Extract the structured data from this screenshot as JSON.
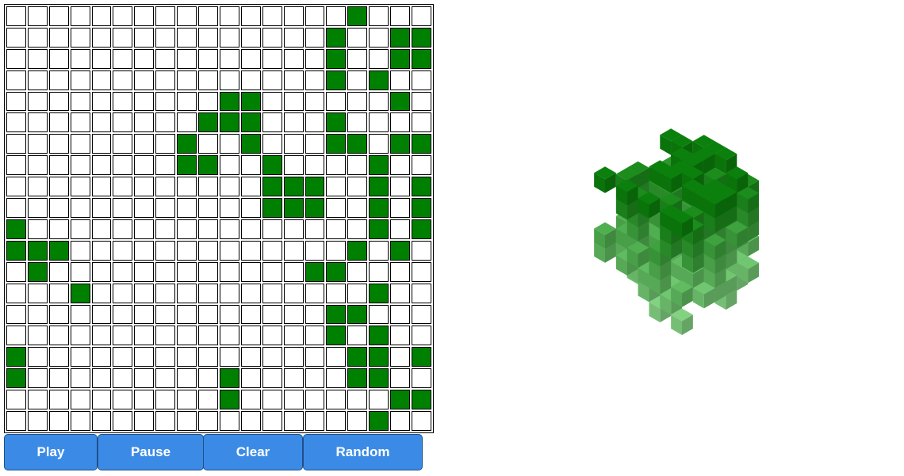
{
  "controls": {
    "buttons": [
      {
        "id": "play",
        "label": "Play"
      },
      {
        "id": "pause",
        "label": "Pause"
      },
      {
        "id": "clear",
        "label": "Clear"
      },
      {
        "id": "random",
        "label": "Random"
      }
    ]
  },
  "grid": {
    "rows": 20,
    "cols": 20,
    "live_color": "#008000",
    "dead_color": "#ffffff",
    "alive": [
      [
        0,
        16
      ],
      [
        1,
        15
      ],
      [
        1,
        18
      ],
      [
        1,
        19
      ],
      [
        2,
        15
      ],
      [
        2,
        18
      ],
      [
        2,
        19
      ],
      [
        3,
        15
      ],
      [
        3,
        17
      ],
      [
        4,
        10
      ],
      [
        4,
        11
      ],
      [
        4,
        18
      ],
      [
        5,
        9
      ],
      [
        5,
        10
      ],
      [
        5,
        11
      ],
      [
        5,
        15
      ],
      [
        6,
        8
      ],
      [
        6,
        11
      ],
      [
        6,
        15
      ],
      [
        6,
        16
      ],
      [
        6,
        18
      ],
      [
        6,
        19
      ],
      [
        7,
        8
      ],
      [
        7,
        9
      ],
      [
        7,
        12
      ],
      [
        7,
        17
      ],
      [
        8,
        12
      ],
      [
        8,
        13
      ],
      [
        8,
        14
      ],
      [
        8,
        17
      ],
      [
        8,
        19
      ],
      [
        9,
        12
      ],
      [
        9,
        13
      ],
      [
        9,
        14
      ],
      [
        9,
        17
      ],
      [
        9,
        19
      ],
      [
        10,
        0
      ],
      [
        10,
        17
      ],
      [
        10,
        19
      ],
      [
        11,
        0
      ],
      [
        11,
        1
      ],
      [
        11,
        2
      ],
      [
        11,
        16
      ],
      [
        11,
        18
      ],
      [
        12,
        1
      ],
      [
        12,
        14
      ],
      [
        12,
        15
      ],
      [
        13,
        3
      ],
      [
        13,
        17
      ],
      [
        14,
        15
      ],
      [
        14,
        16
      ],
      [
        15,
        15
      ],
      [
        15,
        17
      ],
      [
        16,
        0
      ],
      [
        16,
        16
      ],
      [
        16,
        17
      ],
      [
        16,
        19
      ],
      [
        17,
        0
      ],
      [
        17,
        10
      ],
      [
        17,
        16
      ],
      [
        17,
        17
      ],
      [
        18,
        10
      ],
      [
        18,
        18
      ],
      [
        18,
        19
      ],
      [
        19,
        17
      ]
    ]
  },
  "view3d": {
    "colors": {
      "dark": "#0b7a0b",
      "mid": "#2f9a2f",
      "light": "#7cc87c"
    }
  }
}
